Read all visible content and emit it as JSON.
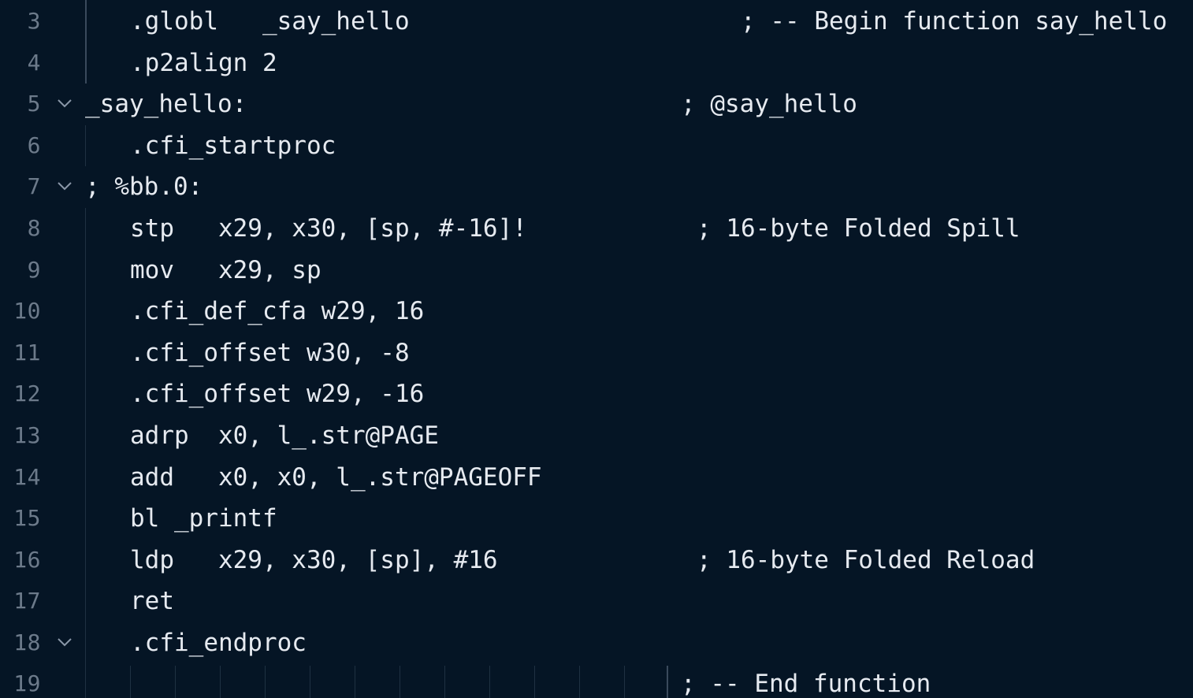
{
  "editor": {
    "lines": [
      {
        "num": "3",
        "code": ".globl   _say_hello",
        "comment": "; -- Begin function say_hello"
      },
      {
        "num": "4",
        "code": ".p2align 2",
        "comment": ""
      },
      {
        "num": "5",
        "code": "_say_hello:",
        "comment": "; @say_hello"
      },
      {
        "num": "6",
        "code": ".cfi_startproc",
        "comment": ""
      },
      {
        "num": "7",
        "code": "; %bb.0:",
        "comment": ""
      },
      {
        "num": "8",
        "code": "stp   x29, x30, [sp, #-16]!",
        "comment": "; 16-byte Folded Spill"
      },
      {
        "num": "9",
        "code": "mov   x29, sp",
        "comment": ""
      },
      {
        "num": "10",
        "code": ".cfi_def_cfa w29, 16",
        "comment": ""
      },
      {
        "num": "11",
        "code": ".cfi_offset w30, -8",
        "comment": ""
      },
      {
        "num": "12",
        "code": ".cfi_offset w29, -16",
        "comment": ""
      },
      {
        "num": "13",
        "code": "adrp  x0, l_.str@PAGE",
        "comment": ""
      },
      {
        "num": "14",
        "code": "add   x0, x0, l_.str@PAGEOFF",
        "comment": ""
      },
      {
        "num": "15",
        "code": "bl _printf",
        "comment": ""
      },
      {
        "num": "16",
        "code": "ldp   x29, x30, [sp], #16",
        "comment": "; 16-byte Folded Reload"
      },
      {
        "num": "17",
        "code": "ret",
        "comment": ""
      },
      {
        "num": "18",
        "code": ".cfi_endproc",
        "comment": ""
      },
      {
        "num": "19",
        "code": "",
        "comment": "; -- End function"
      }
    ]
  },
  "colors": {
    "background": "#051525",
    "text": "#e6eaf0",
    "line_number": "#6c7a8a",
    "indent_guide": "#3a4a5c"
  },
  "icons": {
    "fold": "chevron-down-icon"
  }
}
